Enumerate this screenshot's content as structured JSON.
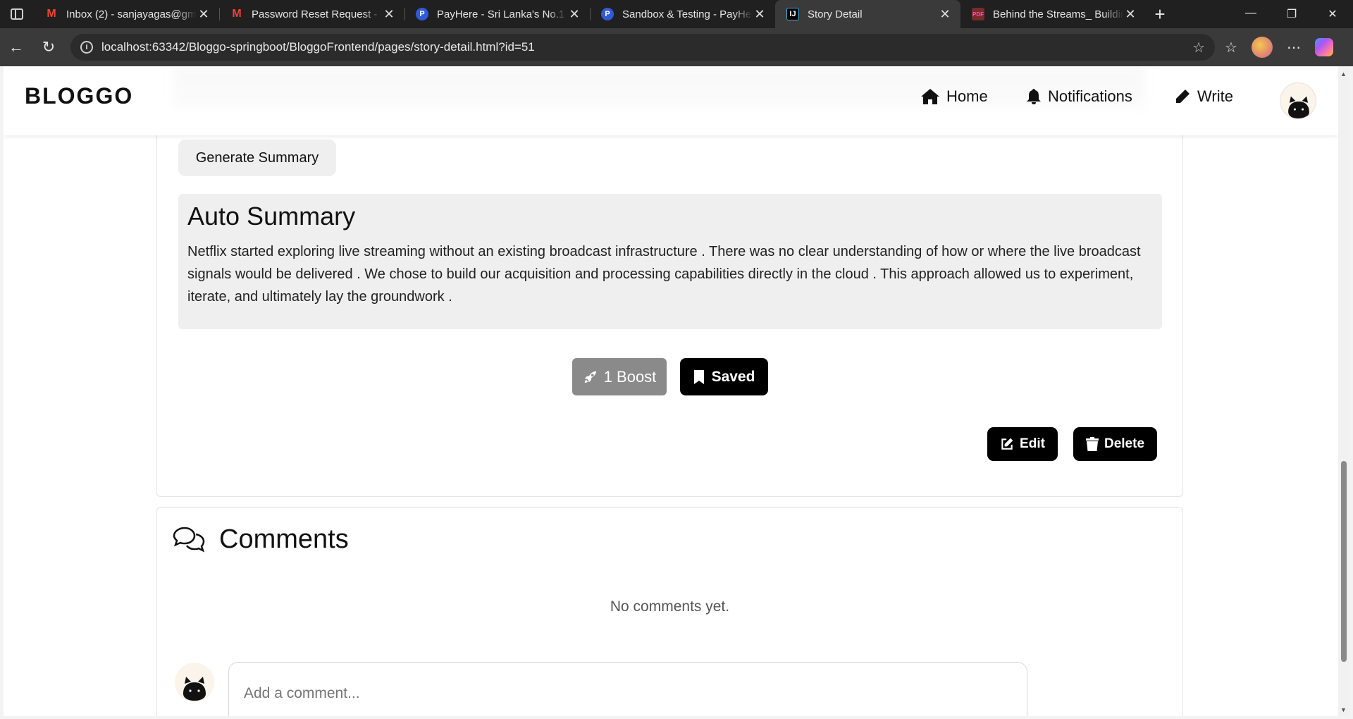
{
  "browser": {
    "tabs": [
      {
        "title": "Inbox (2) - sanjayagas@gmail.com",
        "icon": "gmail-icon",
        "active": false
      },
      {
        "title": "Password Reset Request - sanjaya",
        "icon": "gmail-icon",
        "active": false
      },
      {
        "title": "PayHere - Sri Lanka's No.1 Online",
        "icon": "payhere-icon",
        "active": false
      },
      {
        "title": "Sandbox & Testing - PayHere",
        "icon": "payhere-icon",
        "active": false
      },
      {
        "title": "Story Detail",
        "icon": "intellij-icon",
        "active": true
      },
      {
        "title": "Behind the Streams_ Building",
        "icon": "pdf-icon",
        "active": false
      }
    ],
    "url": "localhost:63342/Bloggo-springboot/BloggoFrontend/pages/story-detail.html?id=51"
  },
  "header": {
    "logo": "BLOGGO",
    "nav": [
      {
        "label": "Home",
        "icon": "home-icon"
      },
      {
        "label": "Notifications",
        "icon": "bell-icon"
      },
      {
        "label": "Write",
        "icon": "pencil-icon"
      }
    ]
  },
  "story": {
    "generate_summary_label": "Generate Summary",
    "summary_title": "Auto Summary",
    "summary_text": "Netflix started exploring live streaming without an existing broadcast infrastructure . There was no clear understanding of how or where the live broadcast signals would be delivered . We chose to build our acquisition and processing capabilities directly in the cloud . This approach allowed us to experiment, iterate, and ultimately lay the groundwork .",
    "boost_label": "1 Boost",
    "saved_label": "Saved",
    "edit_label": "Edit",
    "delete_label": "Delete"
  },
  "comments": {
    "title": "Comments",
    "empty_text": "No comments yet.",
    "input_placeholder": "Add a comment..."
  },
  "colors": {
    "accent": "#000000",
    "boost_bg": "#8a8a8a",
    "summary_bg": "#efefef"
  }
}
